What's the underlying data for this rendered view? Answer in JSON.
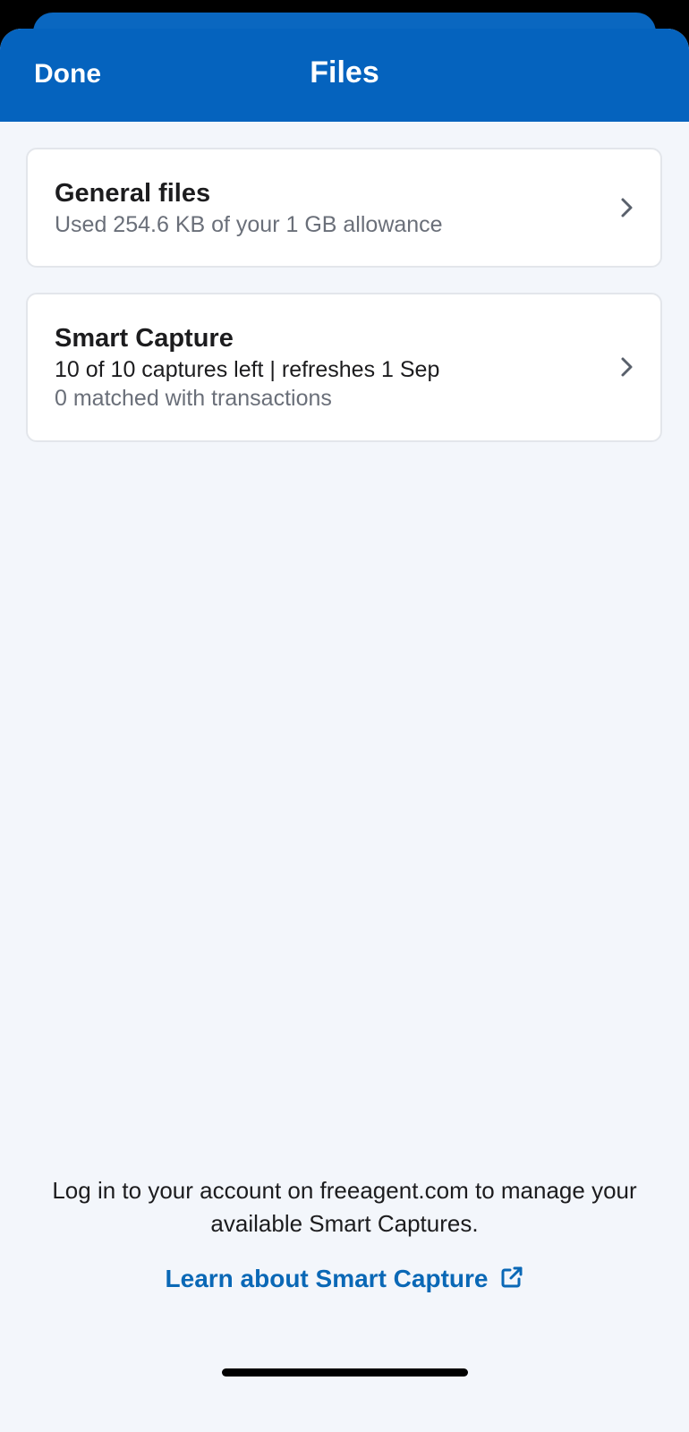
{
  "header": {
    "done_label": "Done",
    "title": "Files"
  },
  "cards": {
    "general": {
      "title": "General files",
      "line1": "Used 254.6 KB of your 1 GB allowance"
    },
    "smart_capture": {
      "title": "Smart Capture",
      "line1": "10 of 10 captures left | refreshes 1 Sep",
      "line2": "0 matched with transactions"
    }
  },
  "footer": {
    "info_text": "Log in to your account on freeagent.com to manage your available Smart Captures.",
    "link_label": "Learn about Smart Capture"
  },
  "colors": {
    "header_blue": "#0563be",
    "link_blue": "#0a68b6",
    "background": "#f3f6fb"
  },
  "icons": {
    "card_chevron": "chevron-right-icon",
    "link_icon": "external-link-icon"
  }
}
